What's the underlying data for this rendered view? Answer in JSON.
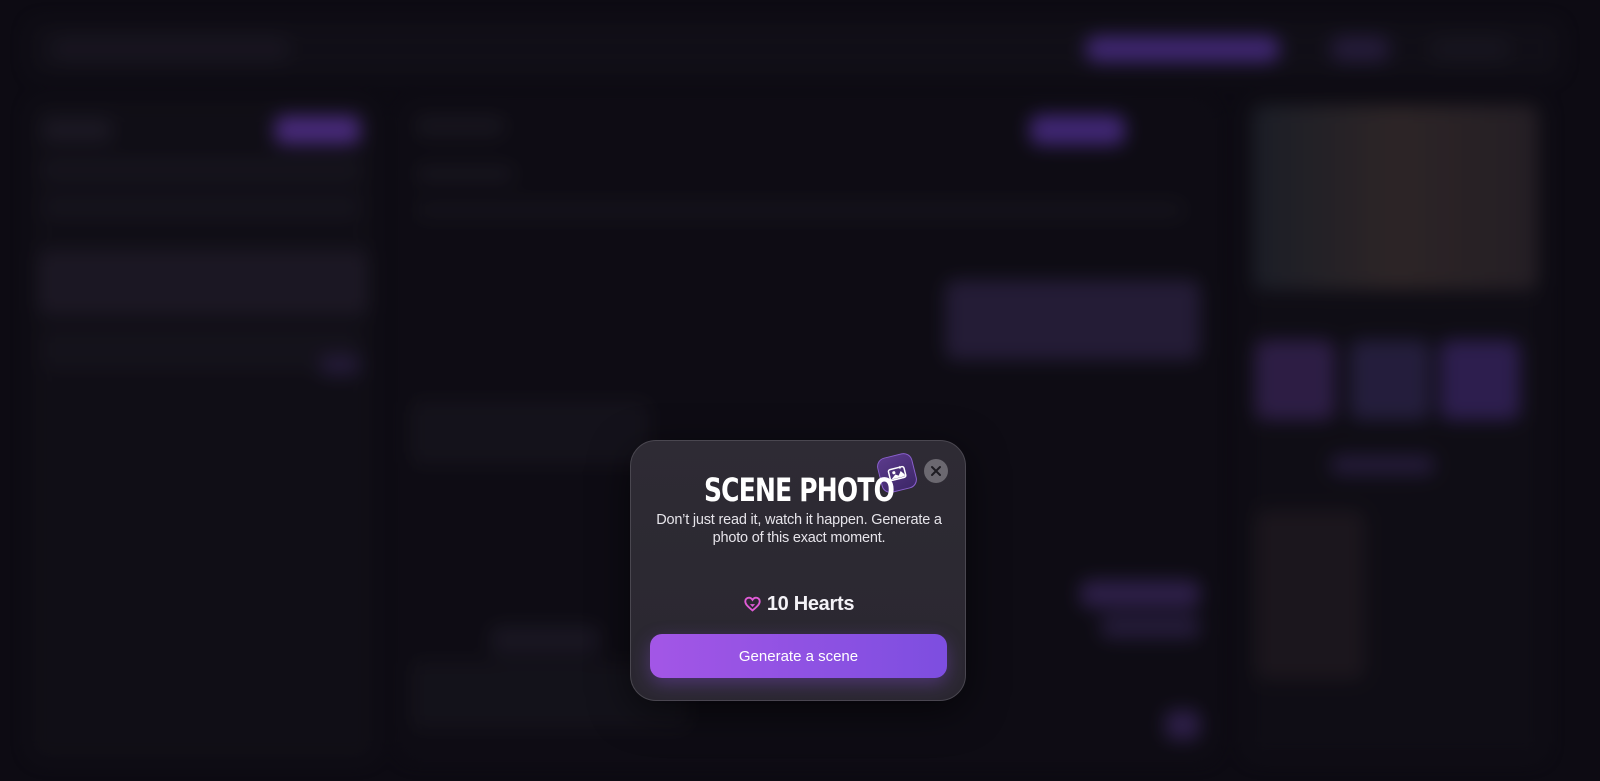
{
  "modal": {
    "title": "SCENE PHOTO",
    "description": "Don’t just read it, watch it happen. Generate a photo of this exact moment.",
    "cost": {
      "icon": "heart-icon",
      "label": "10 Hearts"
    },
    "generate_button_label": "Generate a scene",
    "badge_icon": "photo-icon",
    "close_icon": "close-icon"
  },
  "colors": {
    "accent": "#9a55e6",
    "accent_end": "#7d4ee0",
    "heart": "#e05bd6",
    "modal_bg": "#2c2932",
    "page_bg": "#100d16"
  }
}
